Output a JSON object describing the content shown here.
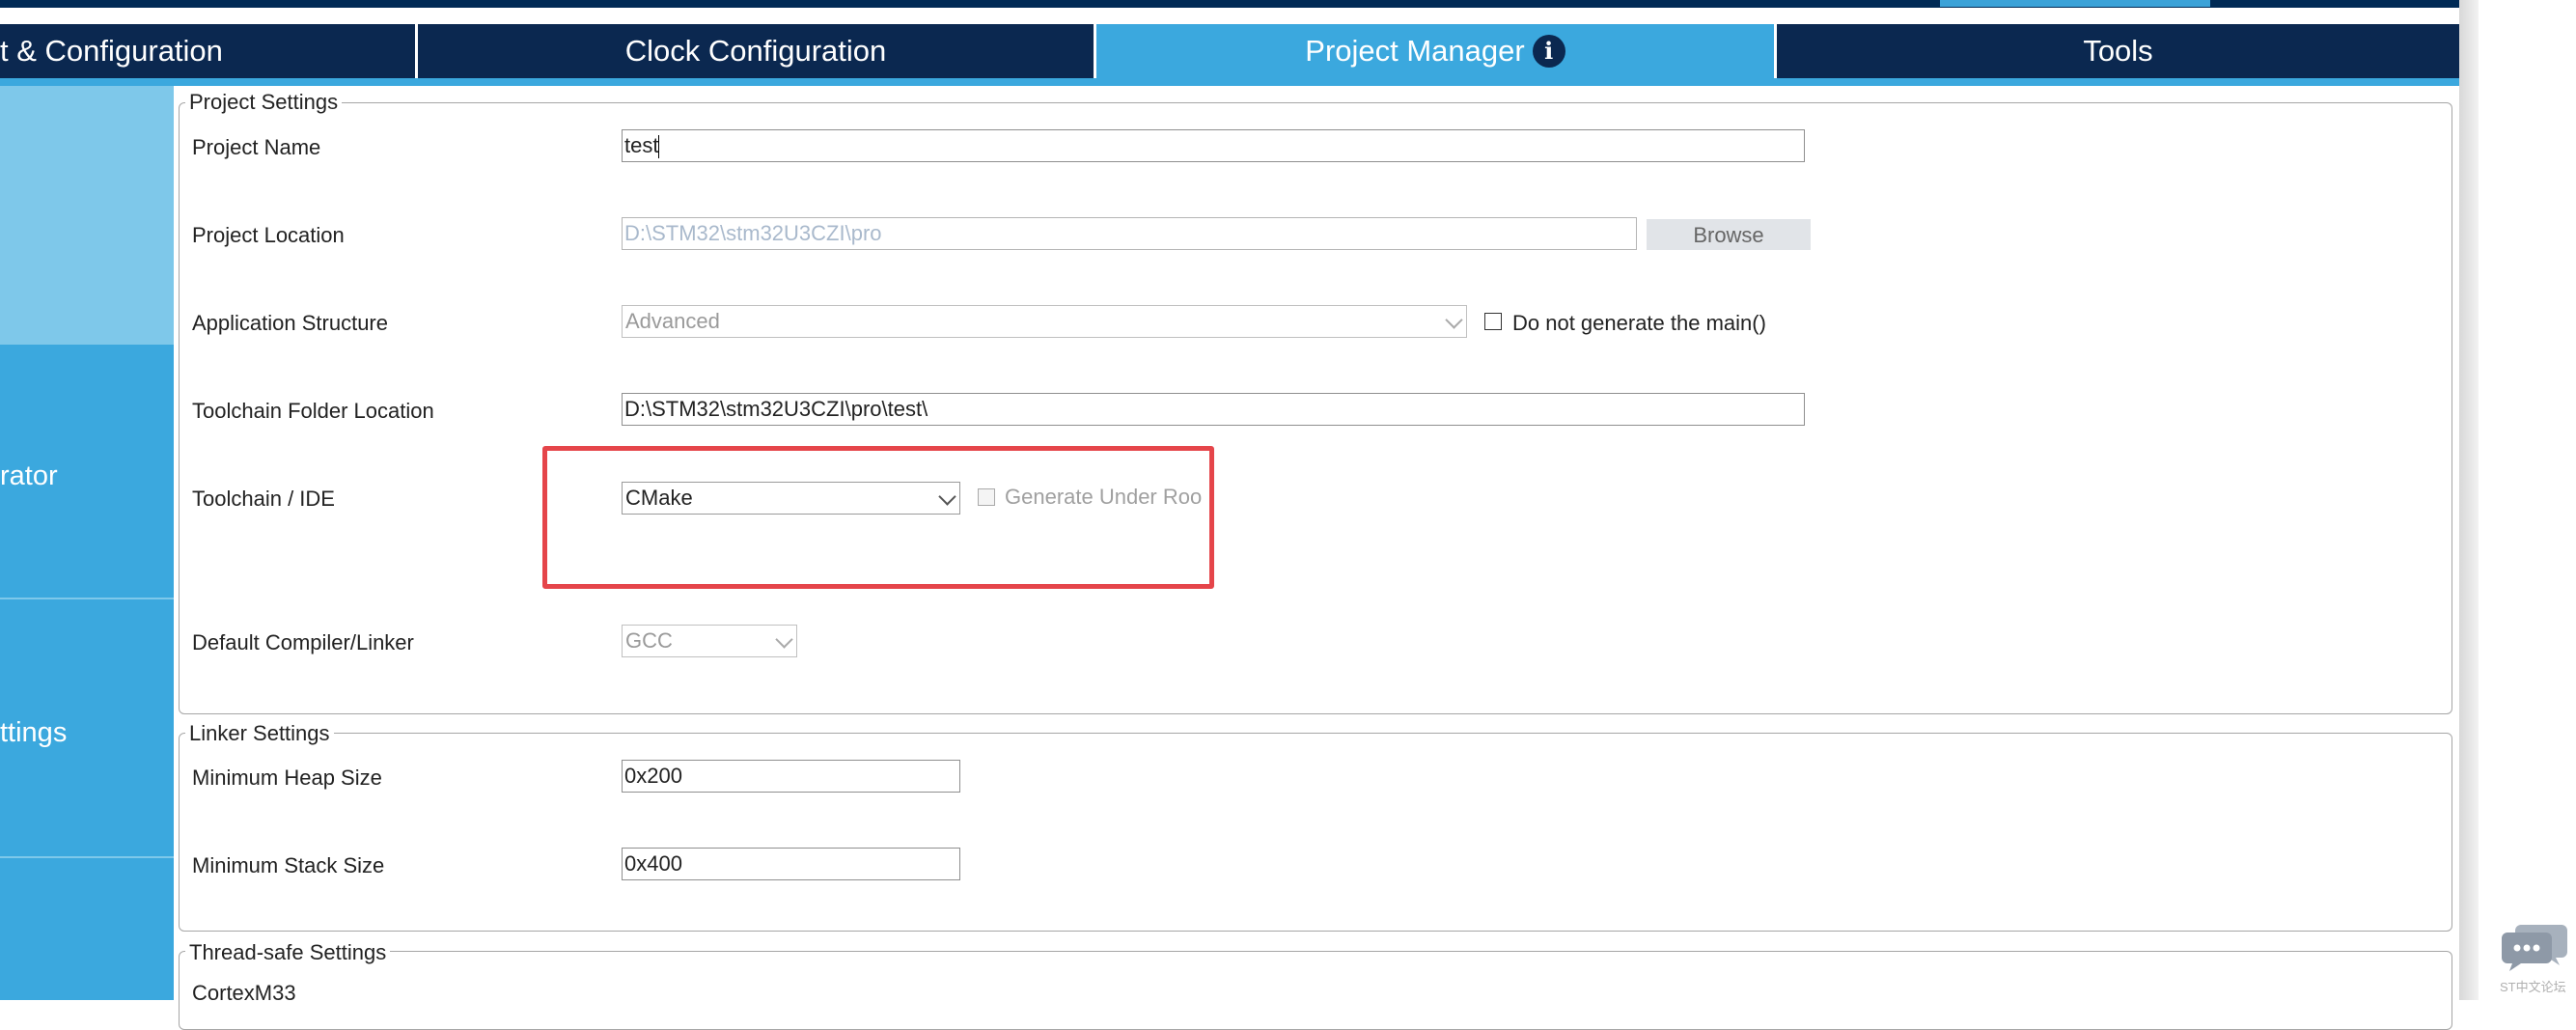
{
  "tabs": [
    {
      "label": "t & Configuration",
      "active": false
    },
    {
      "label": "Clock Configuration",
      "active": false
    },
    {
      "label": "Project Manager",
      "active": true,
      "icon": "info-icon"
    },
    {
      "label": "Tools",
      "active": false
    }
  ],
  "sidebar": {
    "items": [
      {
        "label": ""
      },
      {
        "label": "rator"
      },
      {
        "label": "ttings"
      },
      {
        "label": ""
      }
    ]
  },
  "project_settings": {
    "title": "Project Settings",
    "project_name": {
      "label": "Project Name",
      "value": "test"
    },
    "project_location": {
      "label": "Project Location",
      "value": "D:\\STM32\\stm32U3CZI\\pro",
      "browse_label": "Browse"
    },
    "application_structure": {
      "label": "Application Structure",
      "value": "Advanced",
      "checkbox_label": "Do not generate the main()"
    },
    "toolchain_folder": {
      "label": "Toolchain Folder Location",
      "value": "D:\\STM32\\stm32U3CZI\\pro\\test\\"
    },
    "toolchain_ide": {
      "label": "Toolchain / IDE",
      "value": "CMake",
      "checkbox_label": "Generate Under Roo"
    },
    "compiler": {
      "label": "Default Compiler/Linker",
      "value": "GCC"
    }
  },
  "linker_settings": {
    "title": "Linker Settings",
    "heap": {
      "label": "Minimum Heap Size",
      "value": "0x200"
    },
    "stack": {
      "label": "Minimum Stack Size",
      "value": "0x400"
    }
  },
  "thread_safe": {
    "title": "Thread-safe Settings",
    "core": "CortexM33"
  },
  "watermark": "ST中文论坛",
  "colors": {
    "tab_bar": "#0b2850",
    "tab_active": "#3ba8de",
    "sidebar_top": "#7ec8ea",
    "sidebar": "#3ba8de",
    "highlight": "#e5454a"
  }
}
